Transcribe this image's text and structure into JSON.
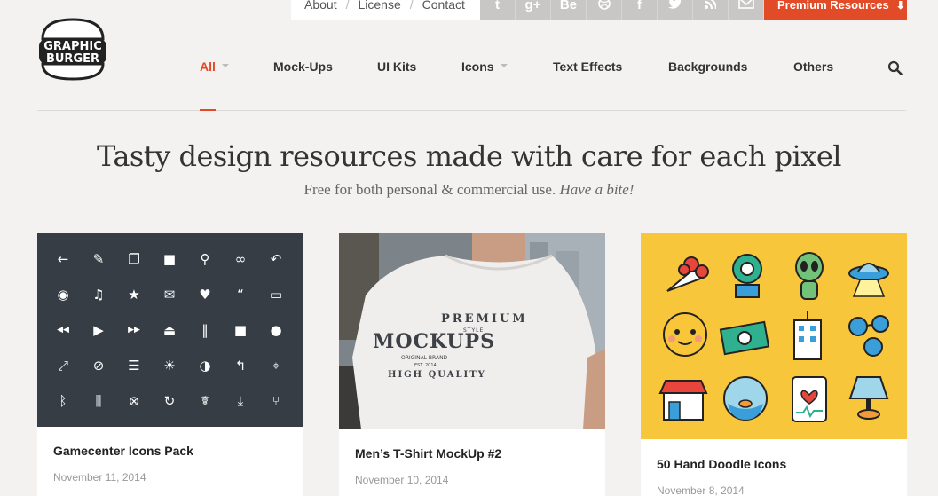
{
  "topbar": {
    "links": [
      "About",
      "License",
      "Contact"
    ],
    "social": [
      "t",
      "g+",
      "Be",
      "dribbble-icon",
      "f",
      "twitter-icon",
      "rss-icon",
      "mail-icon"
    ],
    "premium_label": "Premium Resources"
  },
  "logo": {
    "line1": "GRAPHIC",
    "line2": "BURGER"
  },
  "nav": {
    "items": [
      "All",
      "Mock-Ups",
      "UI Kits",
      "Icons",
      "Text Effects",
      "Backgrounds",
      "Others"
    ],
    "active": "All"
  },
  "hero": {
    "title": "Tasty design resources made with care for each pixel",
    "subtitle": "Free for both personal & commercial use.",
    "subtitle_em": "Have a bite!"
  },
  "cards": [
    {
      "title": "Gamecenter Icons Pack",
      "date": "November 11, 2014"
    },
    {
      "title": "Men’s T-Shirt MockUp #2",
      "date": "November 10, 2014",
      "shirt_lines": [
        "PREMIUM",
        "STYLE",
        "MOCKUPS",
        "ORIGINAL BRAND",
        "EST. 2014",
        "HIGH QUALITY"
      ]
    },
    {
      "title": "50 Hand Doodle Icons",
      "date": "November 8, 2014"
    }
  ],
  "colors": {
    "accent": "#e24b27",
    "bg": "#f3f2f0",
    "icon_panel": "#363d44",
    "doodle_bg": "#f8c63a"
  }
}
